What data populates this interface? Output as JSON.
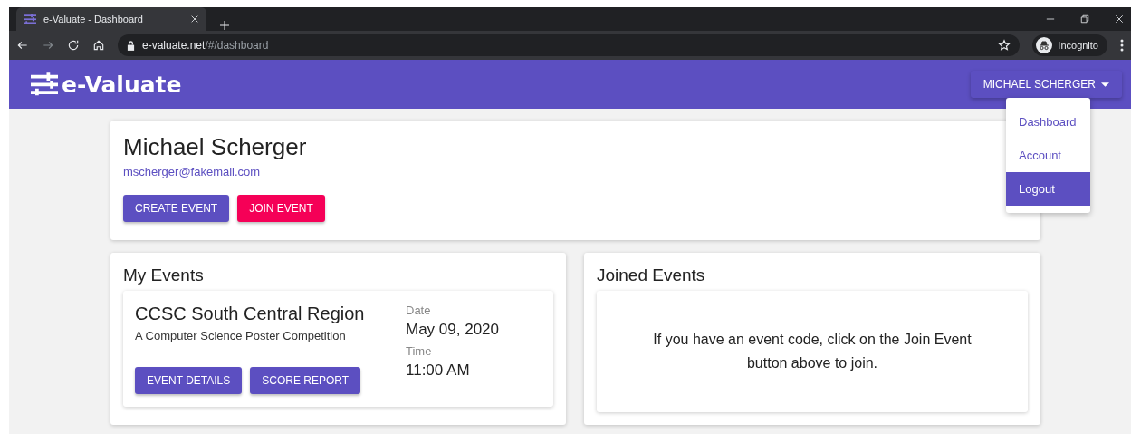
{
  "browser": {
    "tab_title": "e-Valuate - Dashboard",
    "url_host": "e-valuate.net",
    "url_path": "/#/dashboard",
    "profile": "Incognito"
  },
  "app_bar": {
    "logo": "e-Valuate",
    "user_button": "MICHAEL SCHERGER"
  },
  "user_menu": [
    {
      "label": "Dashboard",
      "selected": false
    },
    {
      "label": "Account",
      "selected": false
    },
    {
      "label": "Logout",
      "selected": true
    }
  ],
  "profile": {
    "name": "Michael Scherger",
    "email": "mscherger@fakemail.com",
    "buttons": [
      {
        "label": "CREATE EVENT",
        "kind": "primary"
      },
      {
        "label": "JOIN EVENT",
        "kind": "accent"
      }
    ]
  },
  "my_events": {
    "title": "My Events",
    "events": [
      {
        "name": "CCSC South Central Region",
        "description": "A Computer Science Poster Competition",
        "date_label": "Date",
        "date": "May 09, 2020",
        "time_label": "Time",
        "time": "11:00 AM",
        "buttons": [
          "EVENT DETAILS",
          "SCORE REPORT"
        ]
      }
    ]
  },
  "joined_events": {
    "title": "Joined Events",
    "message": "If you have an event code, click on the Join Event button above to join."
  }
}
